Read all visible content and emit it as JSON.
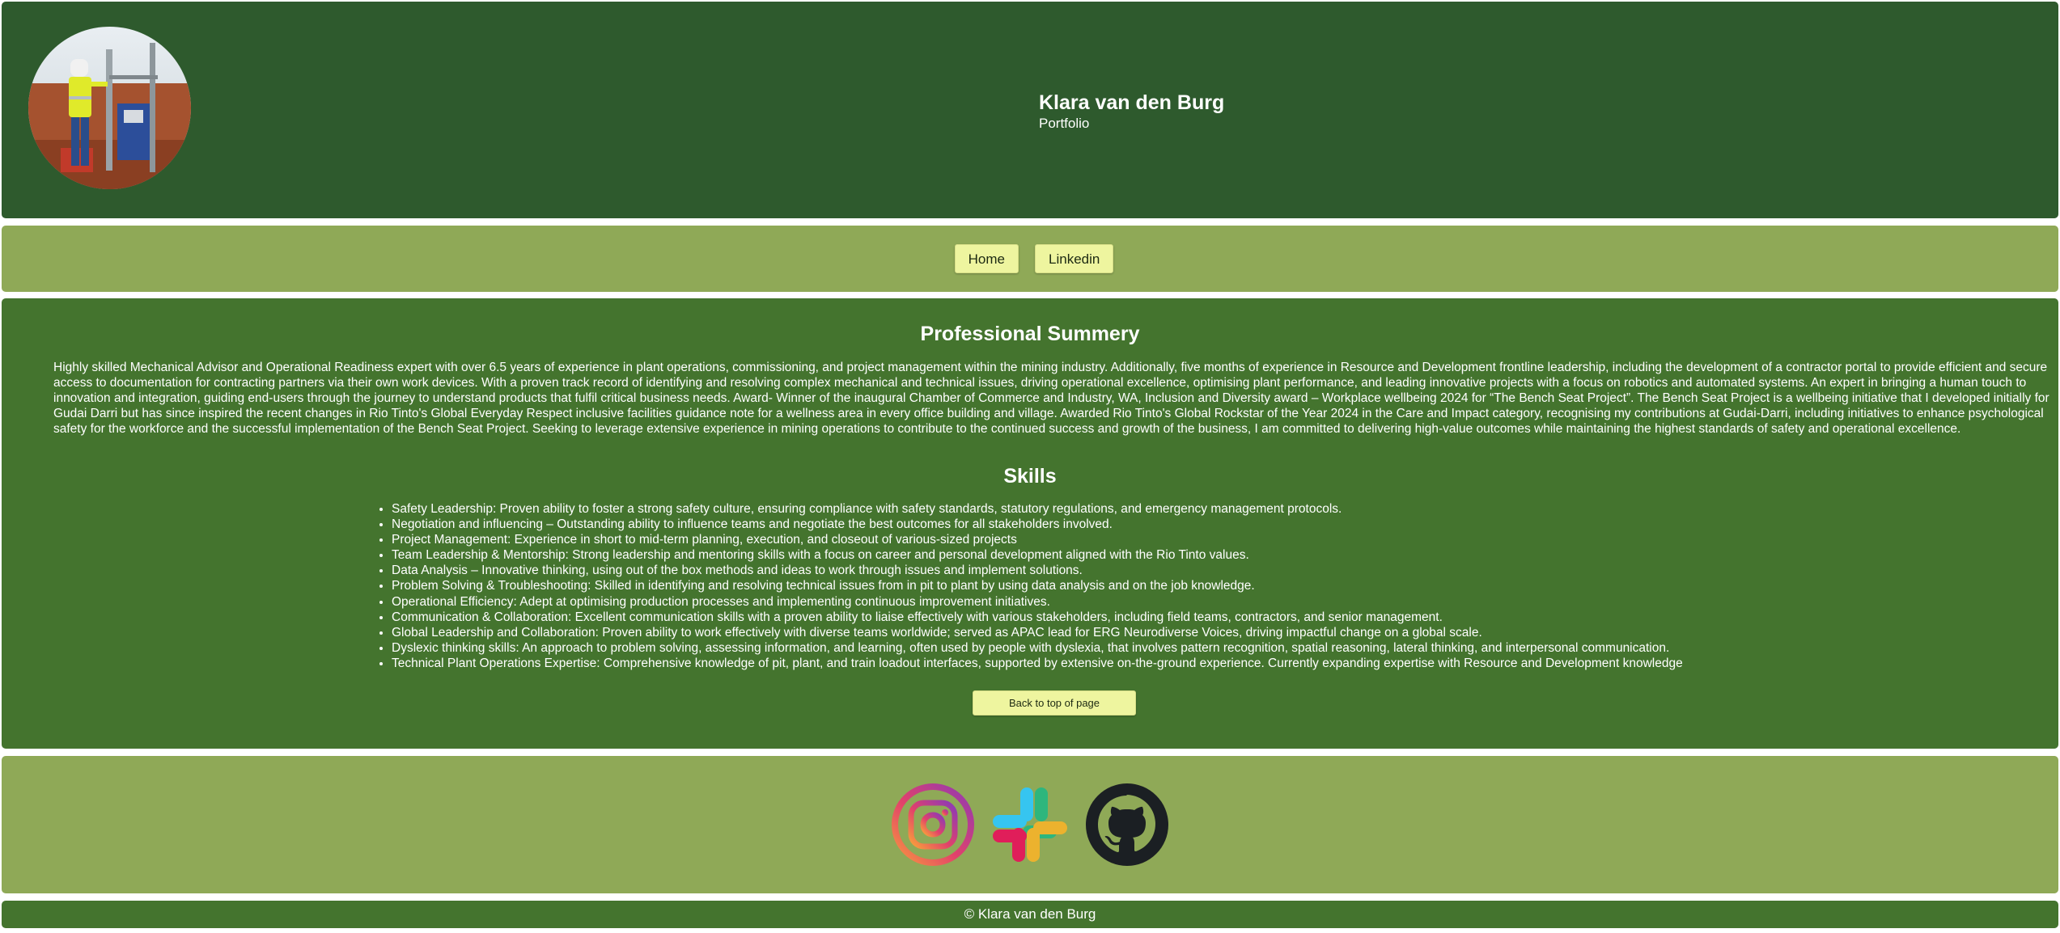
{
  "header": {
    "name": "Klara van den Burg",
    "subtitle": "Portfolio"
  },
  "nav": {
    "items": [
      {
        "label": "Home"
      },
      {
        "label": "Linkedin"
      }
    ]
  },
  "summary": {
    "title": "Professional Summery",
    "text": "Highly skilled Mechanical Advisor and Operational Readiness expert with over 6.5 years of experience in plant operations, commissioning, and project management within the mining industry. Additionally, five months of experience in Resource and Development frontline leadership, including the development of a contractor portal to provide efficient and secure access to documentation for contracting partners via their own work devices.   With a proven track record of identifying and resolving complex mechanical and technical issues, driving operational excellence, optimising plant performance, and leading innovative projects with a focus on robotics and automated systems. An expert in bringing a human touch to innovation and integration, guiding end-users through the journey to understand products that fulfil critical business needs.   Award- Winner of the inaugural Chamber of Commerce and Industry, WA, Inclusion and Diversity award – Workplace wellbeing 2024 for “The Bench Seat Project”. The Bench Seat Project is a wellbeing initiative that I developed initially for Gudai Darri but has since inspired the recent changes in Rio Tinto's Global Everyday Respect inclusive facilities guidance note for a wellness area in every office building and village.   Awarded Rio Tinto's Global Rockstar of the Year 2024 in the Care and Impact category, recognising my contributions at Gudai-Darri, including initiatives to enhance psychological safety for the workforce and the successful implementation of the Bench Seat Project.   Seeking to leverage extensive experience in mining operations to contribute to the continued success and growth of the business, I am committed to delivering high-value outcomes while maintaining the highest standards of safety and operational excellence."
  },
  "skills": {
    "title": "Skills",
    "items": [
      "Safety Leadership: Proven ability to foster a strong safety culture, ensuring compliance with safety standards, statutory regulations, and emergency management protocols.",
      "Negotiation and influencing – Outstanding ability to influence teams and negotiate the best outcomes for all stakeholders involved.",
      "Project Management: Experience in short to mid-term planning, execution, and closeout of various-sized projects",
      "Team Leadership & Mentorship: Strong leadership and mentoring skills with a focus on career and personal development aligned with the Rio Tinto values.",
      "Data Analysis – Innovative thinking, using out of the box methods and ideas to work through issues and implement solutions.",
      "Problem Solving & Troubleshooting: Skilled in identifying and resolving technical issues from in pit to plant by using data analysis and on the job knowledge.",
      "Operational Efficiency: Adept at optimising production processes and implementing continuous improvement initiatives.",
      "Communication & Collaboration: Excellent communication skills with a proven ability to liaise effectively with various stakeholders, including field teams, contractors, and senior management.",
      "Global Leadership and Collaboration: Proven ability to work effectively with diverse teams worldwide; served as APAC lead for ERG Neurodiverse Voices, driving impactful change on a global scale.",
      "Dyslexic thinking skills: An approach to problem solving, assessing information, and learning, often used by people with dyslexia, that involves pattern recognition, spatial reasoning, lateral thinking, and interpersonal communication.",
      "Technical Plant Operations Expertise: Comprehensive knowledge of pit, plant, and train loadout interfaces, supported by extensive on-the-ground experience. Currently expanding expertise with Resource and Development knowledge"
    ]
  },
  "back_to_top": "Back to top of page",
  "social": [
    {
      "icon": "instagram-icon"
    },
    {
      "icon": "slack-icon"
    },
    {
      "icon": "github-icon"
    }
  ],
  "footer": {
    "copyright": "© Klara van den Burg"
  },
  "colors": {
    "header_bg": "#2e5a2d",
    "nav_bg": "#8fa957",
    "main_bg": "#44742e",
    "button_bg": "#eef59f"
  }
}
